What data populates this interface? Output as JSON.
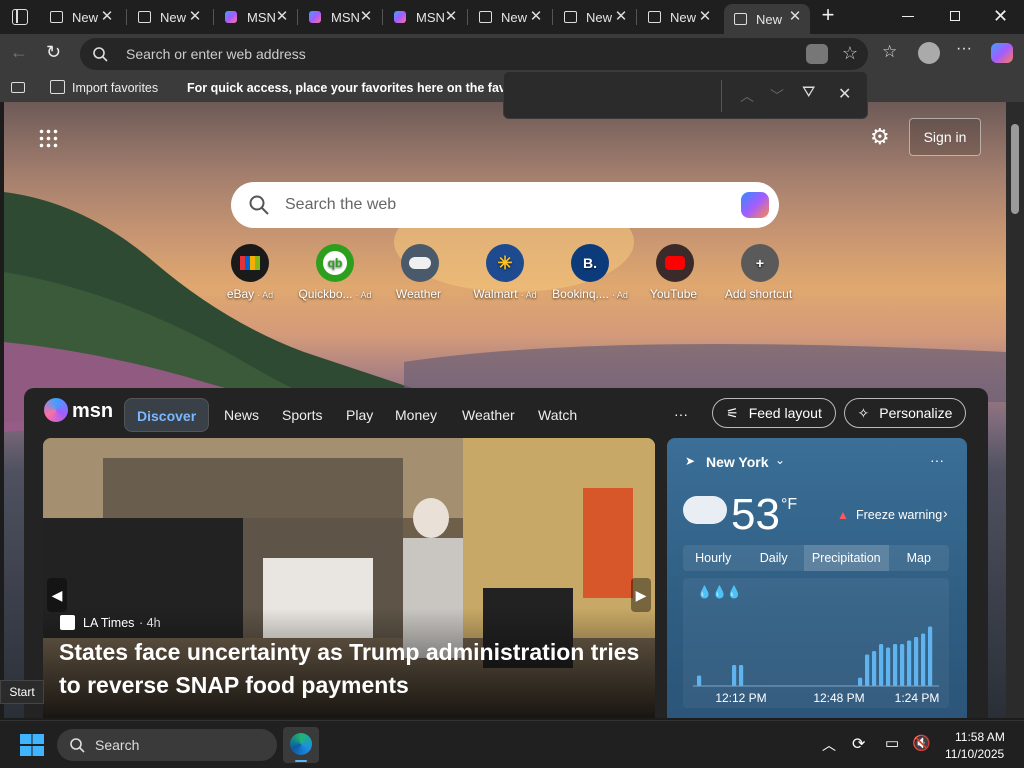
{
  "tabs": [
    {
      "title": "New",
      "icon": "new-tab-icon"
    },
    {
      "title": "New",
      "icon": "new-tab-icon"
    },
    {
      "title": "MSN",
      "icon": "msn-icon"
    },
    {
      "title": "MSN",
      "icon": "msn-icon"
    },
    {
      "title": "MSN",
      "icon": "msn-icon"
    },
    {
      "title": "New",
      "icon": "new-tab-icon"
    },
    {
      "title": "New",
      "icon": "new-tab-icon"
    },
    {
      "title": "New",
      "icon": "new-tab-icon"
    },
    {
      "title": "New",
      "icon": "new-tab-icon",
      "active": true
    }
  ],
  "address": {
    "placeholder": "Search or enter web address"
  },
  "favorites": {
    "import_label": "Import favorites",
    "hint": "For quick access, place your favorites here on the favorites"
  },
  "page": {
    "sign_in": "Sign in",
    "search_placeholder": "Search the web",
    "shortcuts": [
      {
        "label": "eBay",
        "ad": "· Ad",
        "icon": "ebay-icon",
        "bg": "#1a1a1a"
      },
      {
        "label": "Quickbo...",
        "ad": "· Ad",
        "icon": "quickbooks-icon",
        "bg": "#2ca01c"
      },
      {
        "label": "Weather",
        "ad": "",
        "icon": "weather-icon",
        "bg": "#4a5a6b"
      },
      {
        "label": "Walmart",
        "ad": "· Ad",
        "icon": "walmart-icon",
        "bg": "#1e4b8f"
      },
      {
        "label": "Bookinq....",
        "ad": "· Ad",
        "icon": "booking-icon",
        "bg": "#0c3b7c"
      },
      {
        "label": "YouTube",
        "ad": "",
        "icon": "youtube-icon",
        "bg": "#3a2a2a"
      },
      {
        "label": "Add shortcut",
        "ad": "",
        "icon": "plus-icon",
        "bg": "#5a5a5a"
      }
    ]
  },
  "feed": {
    "brand": "msn",
    "nav": [
      "Discover",
      "News",
      "Sports",
      "Play",
      "Money",
      "Weather",
      "Watch"
    ],
    "more": "···",
    "feed_layout": "Feed layout",
    "personalize": "Personalize"
  },
  "news": {
    "source": "LA Times",
    "age": "· 4h",
    "headline": "States face uncertainty as Trump administration tries to reverse SNAP food payments"
  },
  "weather": {
    "city": "New York",
    "temp": "53",
    "unit": "°F",
    "alert": "Freeze warning",
    "tabs": [
      "Hourly",
      "Daily",
      "Precipitation",
      "Map"
    ],
    "active_tab": "Precipitation",
    "times": [
      "12:12 PM",
      "12:48 PM",
      "1:24 PM"
    ],
    "precip_levels": [
      0.15,
      0,
      0,
      0,
      0,
      0.3,
      0.3,
      0,
      0,
      0,
      0,
      0,
      0,
      0,
      0,
      0,
      0,
      0,
      0,
      0,
      0,
      0,
      0,
      0.12,
      0.45,
      0.5,
      0.6,
      0.55,
      0.6,
      0.6,
      0.65,
      0.7,
      0.75,
      0.85
    ]
  },
  "taskbar": {
    "search": "Search",
    "time": "11:58 AM",
    "date": "11/10/2025",
    "start_tooltip": "Start"
  },
  "colors": {
    "accent": "#0078d4",
    "weather_bar": "#5fb4f0"
  }
}
